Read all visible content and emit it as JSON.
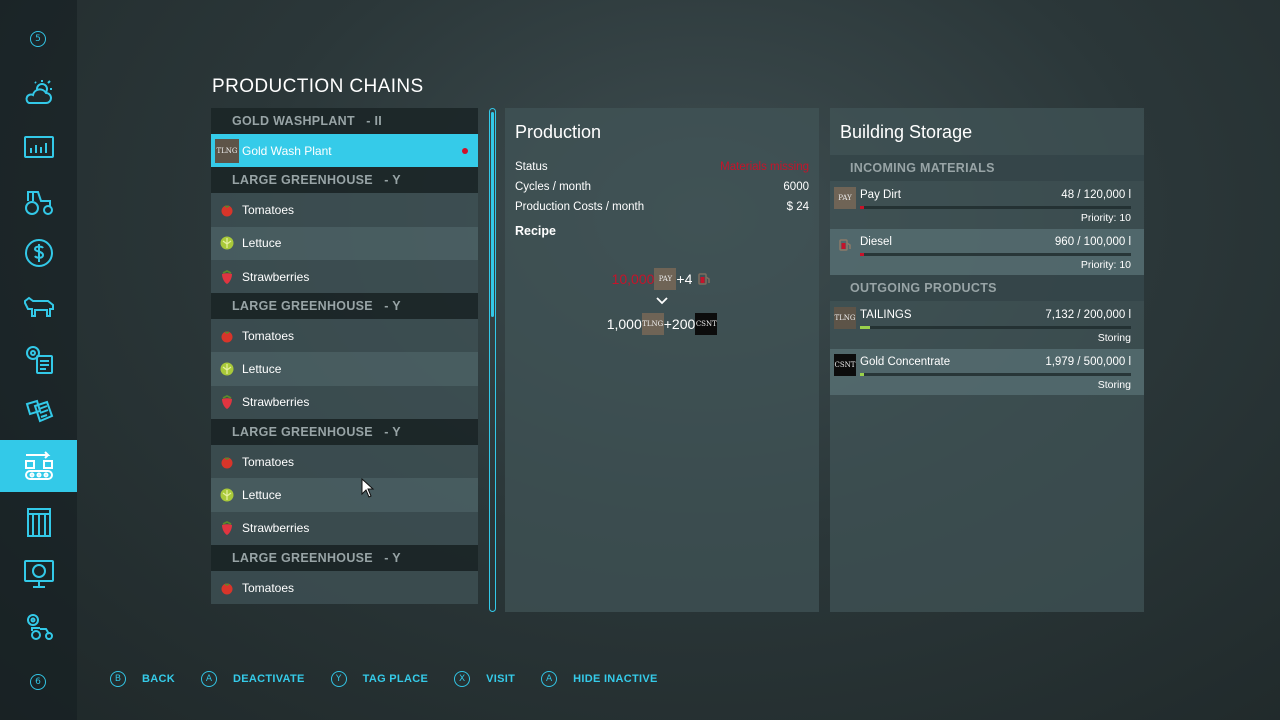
{
  "sidebar": {
    "top_key": "5",
    "bottom_key": "6",
    "items": [
      {
        "icon": "weather-icon"
      },
      {
        "icon": "stats-icon"
      },
      {
        "icon": "tractor-icon"
      },
      {
        "icon": "finances-icon"
      },
      {
        "icon": "animals-icon"
      },
      {
        "icon": "contracts-icon"
      },
      {
        "icon": "price-list-icon"
      },
      {
        "icon": "production-icon",
        "active": true
      },
      {
        "icon": "storage-icon"
      },
      {
        "icon": "help-icon"
      },
      {
        "icon": "settings-tractor-icon"
      }
    ]
  },
  "title": "PRODUCTION CHAINS",
  "production_list": {
    "groups": [
      {
        "header": "GOLD WASHPLANT",
        "suffix": "- II",
        "items": [
          {
            "label": "Gold Wash Plant",
            "thumb": "TLNG",
            "selected": true,
            "alert": true
          }
        ]
      },
      {
        "header": "LARGE GREENHOUSE",
        "suffix": "- Y",
        "items": [
          {
            "label": "Tomatoes"
          },
          {
            "label": "Lettuce"
          },
          {
            "label": "Strawberries"
          }
        ]
      },
      {
        "header": "LARGE GREENHOUSE",
        "suffix": "- Y",
        "items": [
          {
            "label": "Tomatoes"
          },
          {
            "label": "Lettuce"
          },
          {
            "label": "Strawberries"
          }
        ]
      },
      {
        "header": "LARGE GREENHOUSE",
        "suffix": "- Y",
        "items": [
          {
            "label": "Tomatoes"
          },
          {
            "label": "Lettuce"
          },
          {
            "label": "Strawberries"
          }
        ]
      },
      {
        "header": "LARGE GREENHOUSE",
        "suffix": "- Y",
        "items": [
          {
            "label": "Tomatoes"
          }
        ]
      }
    ]
  },
  "production": {
    "title": "Production",
    "status_label": "Status",
    "status_value": "Materials missing",
    "cycles_label": "Cycles / month",
    "cycles_value": "6000",
    "costs_label": "Production Costs / month",
    "costs_value": "$ 24",
    "recipe_label": "Recipe",
    "recipe_input_amount": "10,000",
    "recipe_input_thumb": "PAY",
    "recipe_input_plus": "+4",
    "recipe_output_amount1": "1,000",
    "recipe_output_thumb1": "TLNG",
    "recipe_output_plus": "+200",
    "recipe_output_thumb2": "CSNT"
  },
  "storage": {
    "title": "Building Storage",
    "incoming_header": "INCOMING MATERIALS",
    "outgoing_header": "OUTGOING PRODUCTS",
    "incoming": [
      {
        "name": "Pay Dirt",
        "thumb": "PAY",
        "amount": "48  / 120,000 l",
        "sub": "Priority: 10",
        "fill": 0.0004,
        "color": "#c6132a"
      },
      {
        "name": "Diesel",
        "thumb": "",
        "amount": "960  / 100,000 l",
        "sub": "Priority: 10",
        "fill": 0.0096,
        "color": "#c6132a"
      }
    ],
    "outgoing": [
      {
        "name": "TAILINGS",
        "thumb": "TLNG",
        "amount": "7,132  / 200,000 l",
        "sub": "Storing",
        "fill": 0.036,
        "color": "#9ad14b"
      },
      {
        "name": "Gold Concentrate",
        "thumb": "CSNT",
        "amount": "1,979  / 500,000 l",
        "sub": "Storing",
        "fill": 0.004,
        "color": "#9ad14b"
      }
    ]
  },
  "footer": [
    {
      "key": "B",
      "label": "BACK"
    },
    {
      "key": "A",
      "label": "DEACTIVATE"
    },
    {
      "key": "Y",
      "label": "TAG PLACE"
    },
    {
      "key": "X",
      "label": "VISIT"
    },
    {
      "key": "A",
      "label": "HIDE INACTIVE"
    }
  ],
  "colors": {
    "accent": "#33c9e8",
    "alert": "#c6132a",
    "bar_ok": "#9ad14b"
  }
}
